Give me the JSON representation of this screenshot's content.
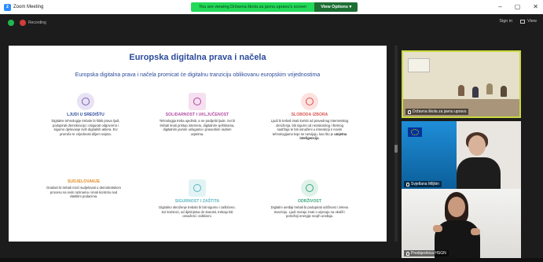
{
  "window": {
    "title": "Zoom Meeting",
    "minimize": "–",
    "maximize": "▢",
    "close": "✕"
  },
  "share_banner": {
    "text": "You are viewing Državna škola za javnu upravu's screen",
    "options_label": "View Options",
    "options_caret": "▾"
  },
  "toolbar": {
    "recording_label": "Recording",
    "signin_label": "Sign in",
    "view_label": "View"
  },
  "slide": {
    "title": "Europska digitalna prava i načela",
    "subtitle": "Europska digitalna prava i načela promicat će digitalnu tranziciju oblikovanu europskim vrijednostima",
    "cards": [
      {
        "head": "LJUDI U SREDIŠTU",
        "body": "Digitalne tehnologije trebale bi štititi prava ljudi, podupirati demokraciju i osigurati odgovorno i sigurno djelovanje svih digitalnih aktera. EU promiče te vrijednosti diljem svijeta."
      },
      {
        "head": "SOLIDARNOST I UKLJUČENOST",
        "body": "Tehnologija treba ujediniti, a ne podijeliti ljude. Svi bi trebali imati pristup internetu, digitalnim vještinama, digitalnim javnim uslugama i pravednim radnim uvjetima."
      },
      {
        "head": "SLOBODA IZBORA",
        "body_pre": "Ljudi bi trebali imati koristi od pravednog internetskog okruženja, biti sigurni od nezakonitog i štetnog sadržaja te biti osnaženi u interakciji s novim tehnologijama koje se razvijaju, kao što je ",
        "body_bold": "umjetna inteligencija",
        "body_post": "."
      },
      {
        "head": "SUDJELOVANJE",
        "body": "Građani bi trebali moći sudjelovati u demokratskom procesu na svim razinama i imati kontrolu nad vlastitim podacima."
      },
      {
        "head": "SIGURNOST I ZAŠTITA",
        "body": "Digitalno okruženje trebalo bi biti sigurno i zaštićeno. Svi korisnici, od djetinjstva do starosti, trebaju biti osnaženi i zaštićeni."
      },
      {
        "head": "ODRŽIVOST",
        "body": "Digitalni uređaji trebali bi podupirati održivost i zelenu tranziciju. Ljudi moraju znati o utjecaju na okoliš i potrošnji energije svojih uređaja."
      }
    ]
  },
  "participants": [
    {
      "name": "Državna škola za javnu upravu"
    },
    {
      "name": "Svjetlana Miljkin"
    },
    {
      "name": "Predsjednica HSGN"
    }
  ],
  "colors": {
    "slide_title": "#2c4a9a",
    "share_banner": "#23d959",
    "active_speaker_border": "#c9d941",
    "recording": "#d13c3c"
  }
}
